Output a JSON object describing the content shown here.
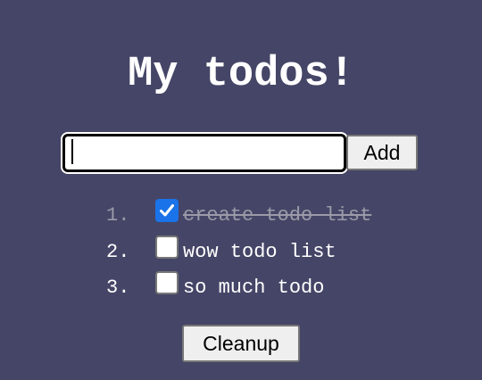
{
  "title": "My todos!",
  "input": {
    "value": "",
    "placeholder": ""
  },
  "add_button_label": "Add",
  "todos": [
    {
      "number": "1.",
      "text": "create todo list",
      "done": true
    },
    {
      "number": "2.",
      "text": "wow todo list",
      "done": false
    },
    {
      "number": "3.",
      "text": "so much todo",
      "done": false
    }
  ],
  "cleanup_button_label": "Cleanup",
  "colors": {
    "background": "#454567",
    "checkbox_checked": "#1a73e8",
    "done_text": "#9a9aa8"
  },
  "icons": {
    "checked": "check-icon"
  }
}
